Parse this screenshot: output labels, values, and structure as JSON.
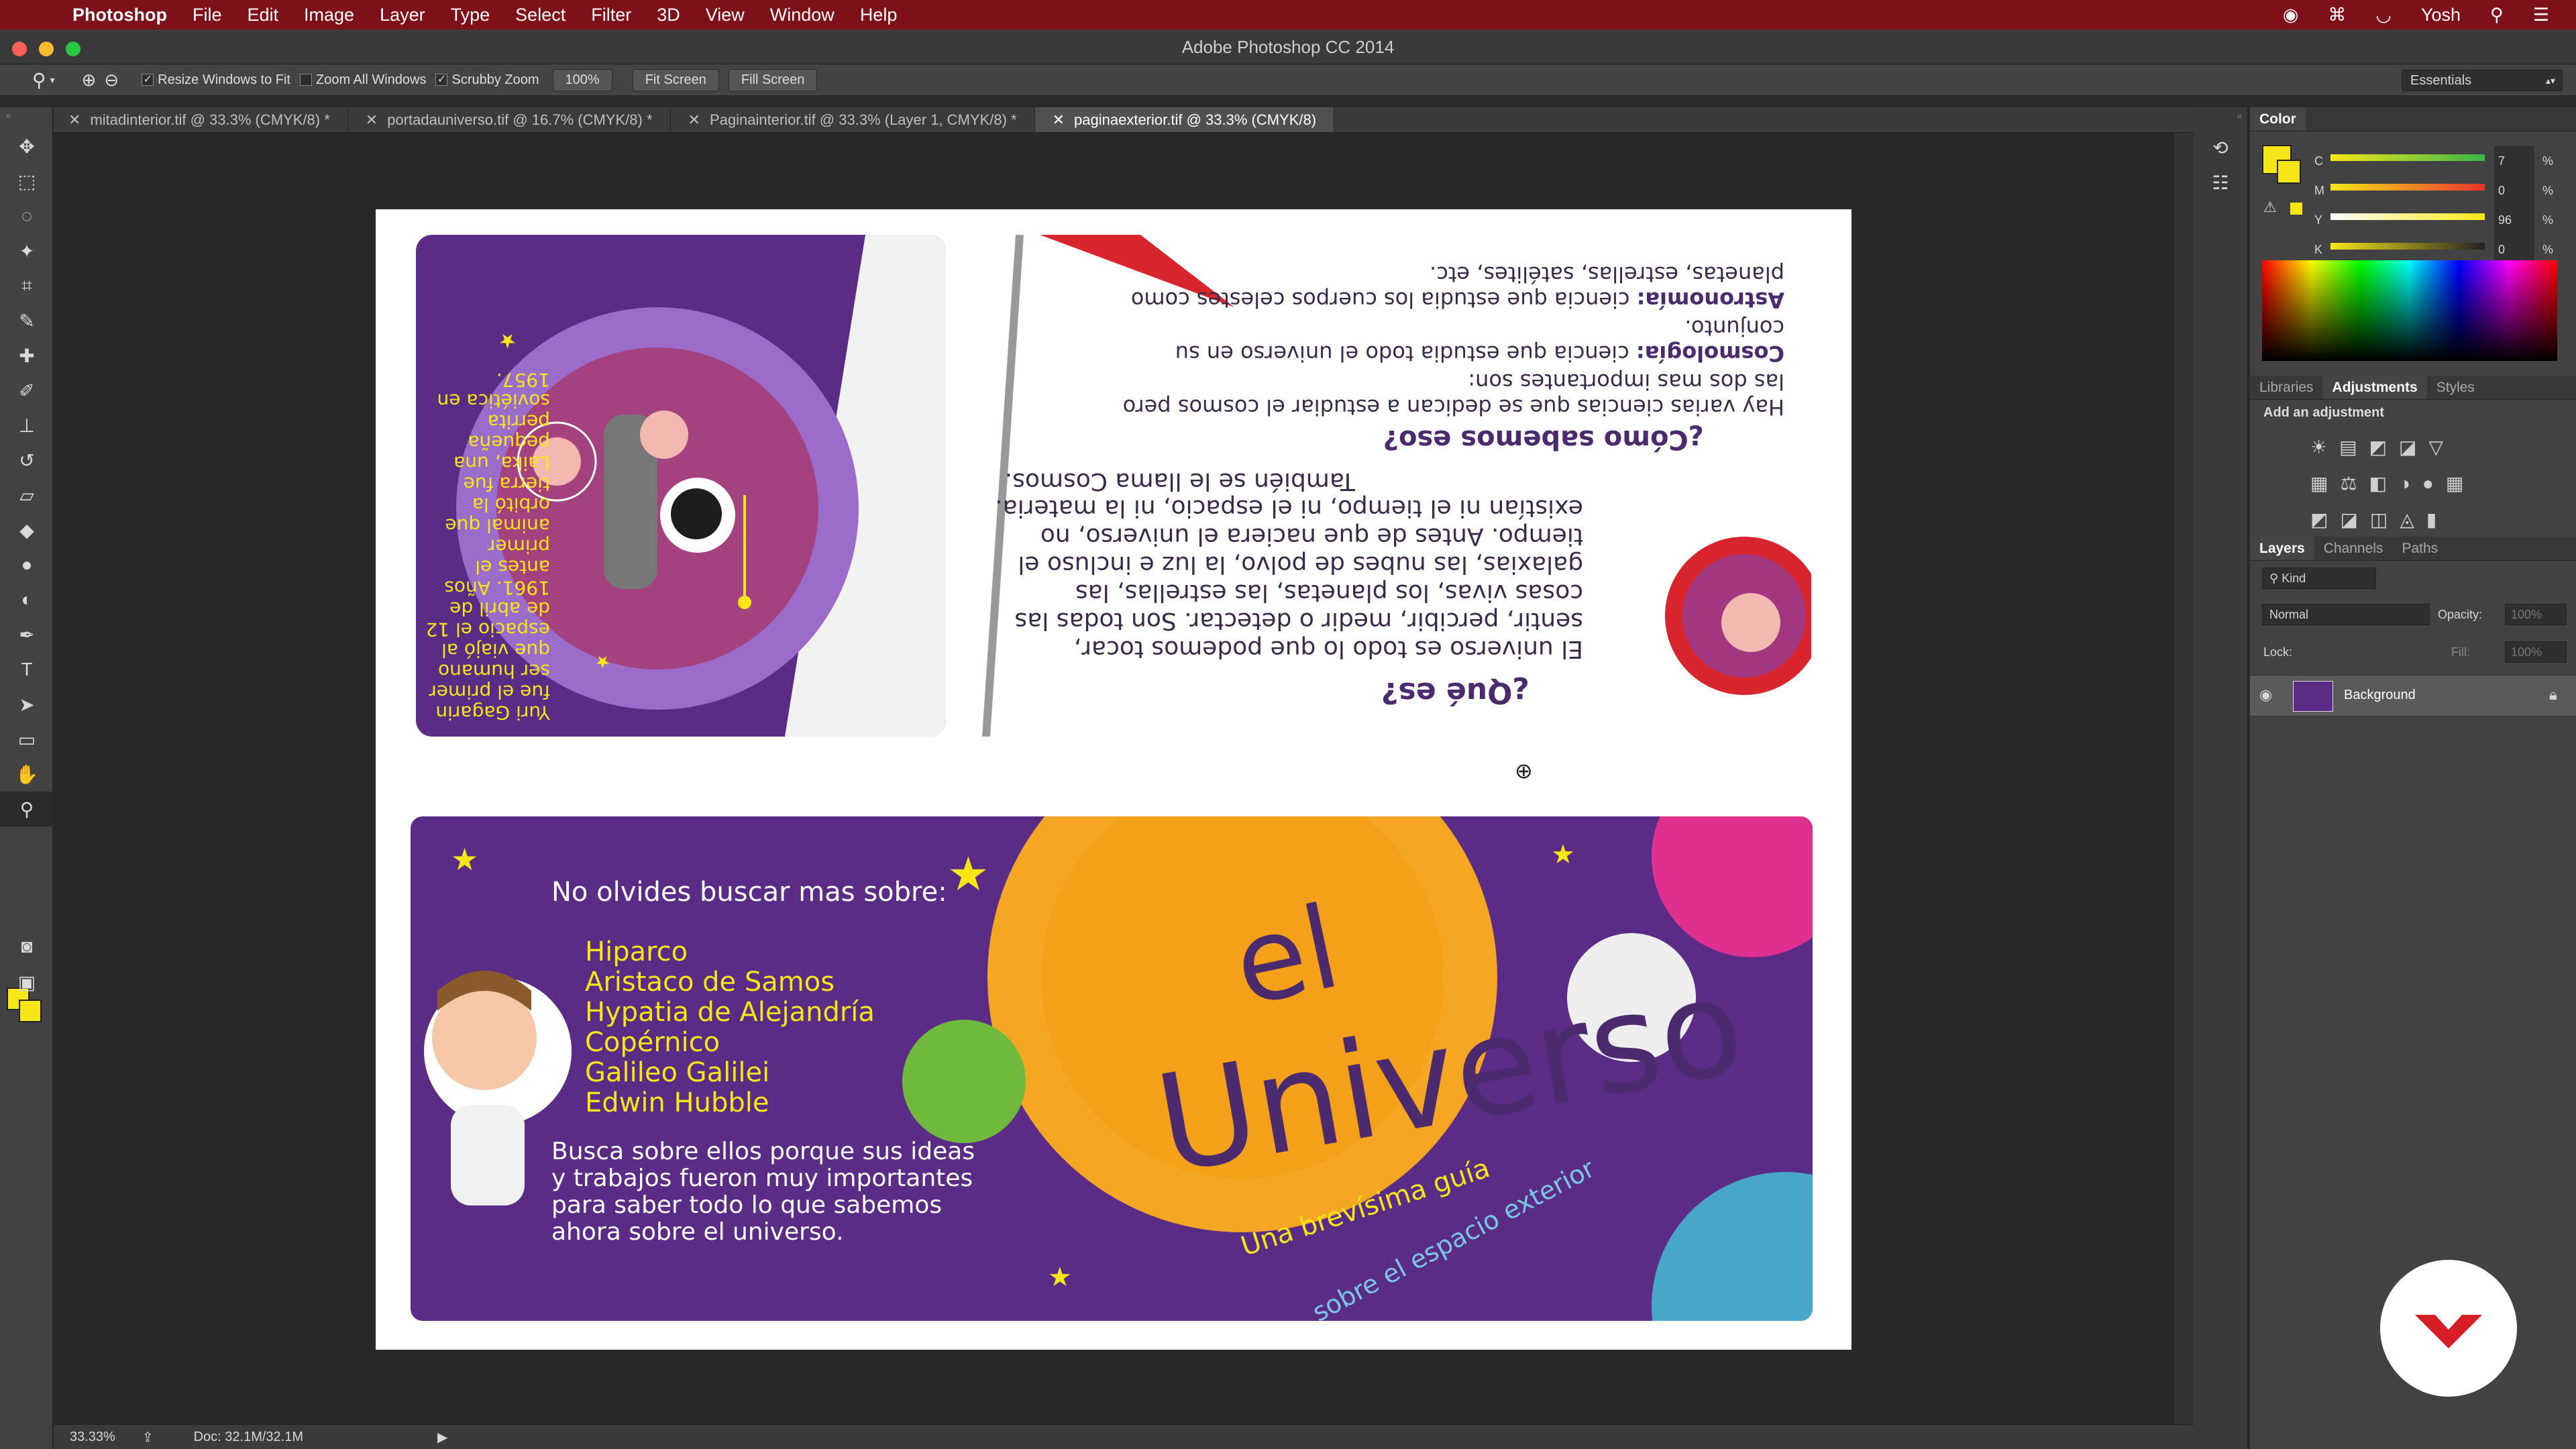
{
  "menubar": {
    "app": "Photoshop",
    "items": [
      "File",
      "Edit",
      "Image",
      "Layer",
      "Type",
      "Select",
      "Filter",
      "3D",
      "View",
      "Window",
      "Help"
    ],
    "user": "Yosh"
  },
  "window": {
    "title": "Adobe Photoshop CC 2014"
  },
  "options": {
    "resize_windows": "Resize Windows to Fit",
    "zoom_all": "Zoom All Windows",
    "scrubby": "Scrubby Zoom",
    "zoom_value": "100%",
    "fit_screen": "Fit Screen",
    "fill_screen": "Fill Screen",
    "workspace": "Essentials"
  },
  "tabs": [
    {
      "label": "mitadinterior.tif @ 33.3% (CMYK/8) *"
    },
    {
      "label": "portadauniverso.tif @ 16.7% (CMYK/8) *"
    },
    {
      "label": "Paginainterior.tif @ 33.3% (Layer 1, CMYK/8) *"
    },
    {
      "label": "paginaexterior.tif @ 33.3% (CMYK/8)"
    }
  ],
  "color_panel": {
    "title": "Color",
    "c_label": "C",
    "m_label": "M",
    "y_label": "Y",
    "k_label": "K",
    "c": "7",
    "m": "0",
    "y": "96",
    "k": "0",
    "pct": "%",
    "fg": "#f7e617"
  },
  "panels": {
    "libraries": "Libraries",
    "adjustments": "Adjustments",
    "styles": "Styles",
    "add_adjustment": "Add an adjustment",
    "layers": "Layers",
    "channels": "Channels",
    "paths": "Paths",
    "kind": "Kind",
    "blend": "Normal",
    "opacity_label": "Opacity:",
    "opacity": "100%",
    "lock_label": "Lock:",
    "fill_label": "Fill:",
    "fill": "100%",
    "layer_name": "Background"
  },
  "status": {
    "zoom": "33.33%",
    "doc": "Doc: 32.1M/32.1M"
  },
  "artwork": {
    "top": {
      "que_es": "¿Qué es?",
      "para1": "El universo es todo lo que podemos tocar, sentir, percibir, medir o detectar. Son todas las cosas vivas, los planetas, las estrellas, las galaxias, las nubes de polvo, la luz e incluso el tiempo. Antes de que naciera el universo, no existían ni el tiempo, ni el espacio, ni la materia.",
      "cosmos": "También se le llama Cosmos.",
      "como_sabemos": "¿Cómo sabemos eso?",
      "para2": "Hay varias ciencias que se dedican a estudiar el cosmos pero las dos mas importantes son:",
      "cosmologia_term": "Cosmología:",
      "cosmologia_def": "ciencia que estudia todo el universo en su conjunto.",
      "astronomia_term": "Astronomía:",
      "astronomia_def": "ciencia que estudia los cuerpos celestes como planetas, estrellas, satélites, etc.",
      "gagarin": "Yuri Gagarin fue el primer ser humano que viajó al espacio el 12 de abril de 1961. Años antes el primer animal que orbitó la tierra fue Laika, una pequeña perrita soviética en 1957."
    },
    "bottom": {
      "buscar": "No olvides buscar mas sobre:",
      "names": [
        "Hiparco",
        "Aristaco de Samos",
        "Hypatia de Alejandría",
        "Copérnico",
        "Galileo Galilei",
        "Edwin Hubble"
      ],
      "busca": "Busca sobre ellos porque sus ideas y trabajos fueron muy importantes para saber todo lo que sabemos ahora sobre el universo.",
      "el": "el",
      "universo": "Universo",
      "subtitle1": "Una brevísima guía",
      "subtitle2": "sobre el espacio exterior"
    }
  }
}
